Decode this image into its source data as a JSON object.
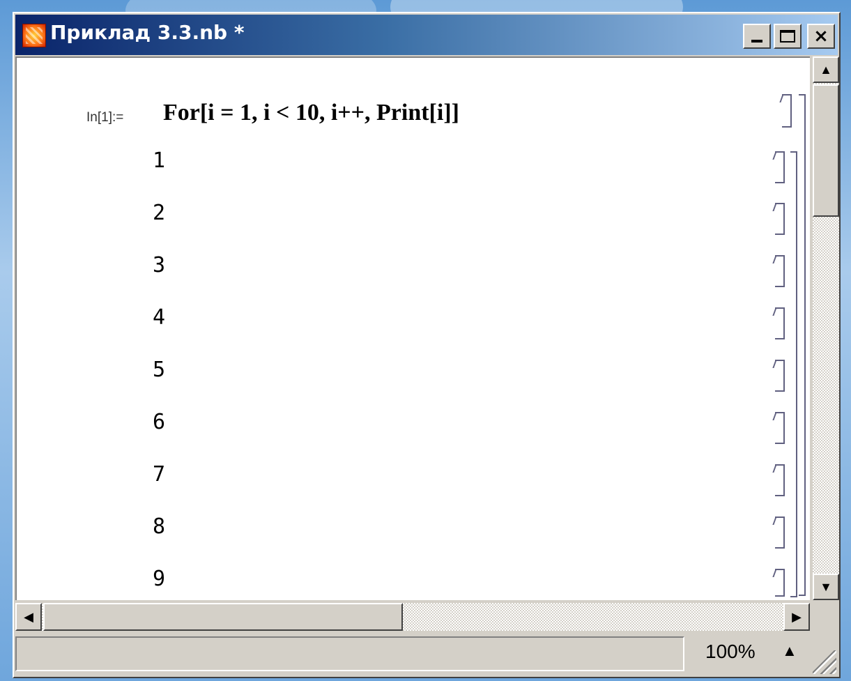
{
  "window": {
    "title": "Приклад 3.3.nb *",
    "buttons": {
      "minimize": "_",
      "maximize": "□",
      "close": "×"
    }
  },
  "notebook": {
    "input_label": "In[1]:=",
    "input_code": "For[i = 1, i < 10, i++, Print[i]]",
    "outputs": [
      "1",
      "2",
      "3",
      "4",
      "5",
      "6",
      "7",
      "8",
      "9"
    ]
  },
  "status": {
    "zoom": "100%"
  },
  "colors": {
    "titlebar_start": "#0a246a",
    "titlebar_end": "#a6caf0",
    "window_face": "#d4d0c8",
    "bracket": "#606080"
  },
  "icons": [
    "app-icon",
    "minimize-icon",
    "maximize-icon",
    "close-icon",
    "scroll-up-icon",
    "scroll-down-icon",
    "scroll-left-icon",
    "scroll-right-icon",
    "zoom-arrow-icon",
    "resize-grip-icon"
  ]
}
